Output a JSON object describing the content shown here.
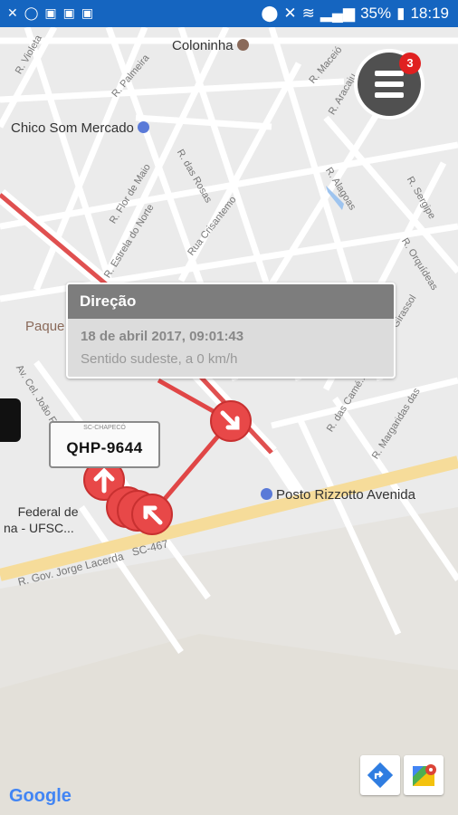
{
  "status_bar": {
    "left_icons": [
      "call-missed-icon",
      "ring-icon",
      "image-icon",
      "gallery-icon",
      "gallery2-icon"
    ],
    "battery": "35%",
    "time": "18:19"
  },
  "map": {
    "places": [
      {
        "name": "Coloninha"
      },
      {
        "name": "Chico Som Mercado"
      },
      {
        "name": "Posto Rizzotto Avenida"
      },
      {
        "name": "Paque"
      },
      {
        "name": "Federal de\nna - UFSC..."
      }
    ],
    "streets": [
      "R. Violeta",
      "R. Palmeira",
      "R. Maceió",
      "R. Aracaju",
      "R. Flor de Maio",
      "R. das Rosas",
      "R. Estrela do Norte",
      "Rua Crisantemo",
      "R. Alagoas",
      "R. Sergipe",
      "R. Orquídeas",
      "Av. Cel. João Fernan...",
      "R. das Camé...",
      "R. Margaridas das",
      "R. Gov. Jorge Lacerda",
      "SC-467",
      "Girassol"
    ],
    "menu_badge": "3",
    "popup": {
      "title": "Direção",
      "date": "18 de abril 2017, 09:01:43",
      "direction": "Sentido sudeste, a 0 km/h"
    },
    "vehicle_plate": {
      "header": "SC-CHAPECÓ",
      "number": "QHP-9644"
    },
    "attribution": "Google"
  }
}
